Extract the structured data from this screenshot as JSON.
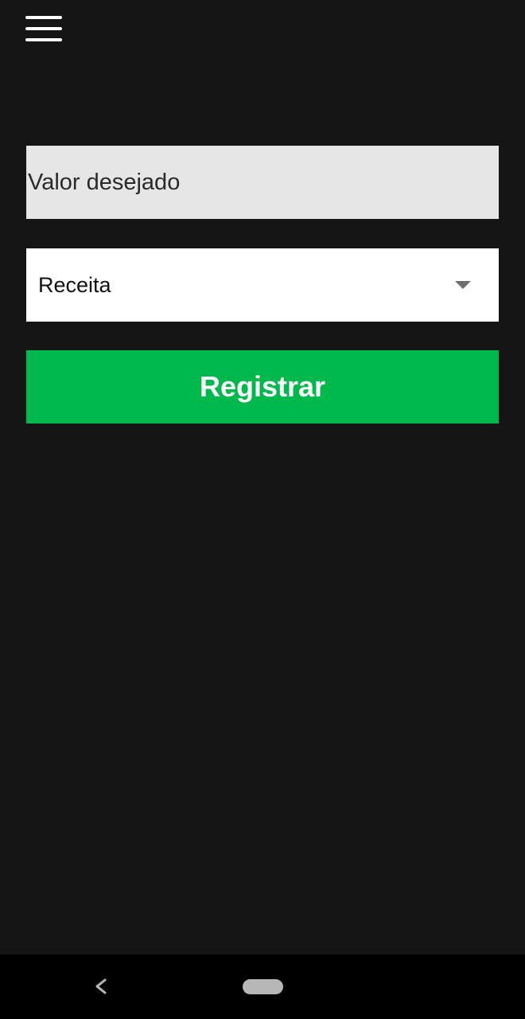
{
  "header": {
    "menu_icon": "hamburger-menu-icon"
  },
  "form": {
    "value_placeholder": "Valor desejado",
    "type_select": {
      "selected": "Receita",
      "icon": "dropdown-arrow-icon"
    },
    "register_label": "Registrar"
  },
  "nav_bar": {
    "back_icon": "back-chevron-icon",
    "home_icon": "home-pill-icon"
  },
  "colors": {
    "background": "#141414",
    "input_background": "#e6e6e6",
    "select_background": "#ffffff",
    "button_background": "#00b94d",
    "button_text": "#ffffff",
    "nav_bar": "#000000"
  }
}
